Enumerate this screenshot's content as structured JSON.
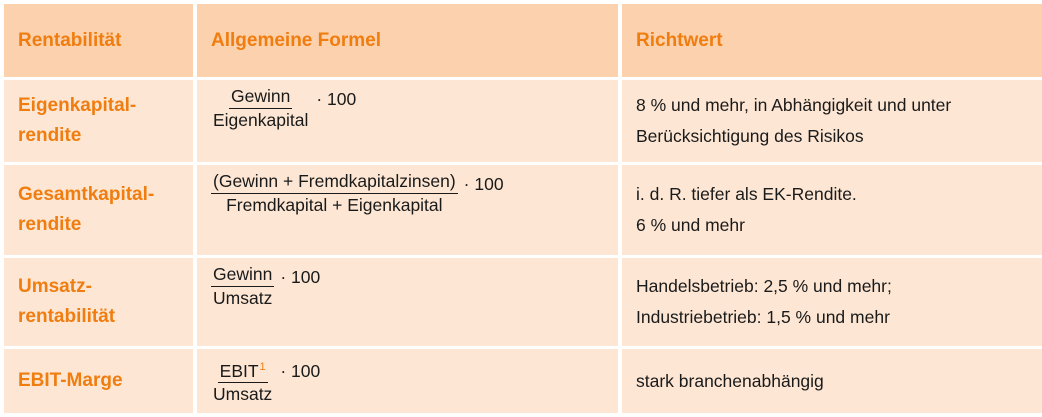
{
  "header": {
    "col1": "Rentabilität",
    "col2": "Allgemeine Formel",
    "col3": "Richtwert"
  },
  "rows": [
    {
      "name": "Eigenkapital-\nrendite",
      "numerator": "Gewinn",
      "denominator": "Eigenkapital",
      "multiplier": "· 100",
      "richtwert": "8 % und mehr, in Abhängigkeit und unter\nBerücksichtigung des Risikos"
    },
    {
      "name": "Gesamtkapital-\nrendite",
      "numerator": "(Gewinn + Fremdkapitalzinsen)",
      "denominator": "Fremdkapital + Eigenkapital",
      "multiplier": "· 100",
      "richtwert": "i. d. R. tiefer als EK-Rendite.\n6 % und mehr"
    },
    {
      "name": "Umsatz-\nrentabilität",
      "numerator": "Gewinn",
      "denominator": "Umsatz",
      "multiplier": "· 100",
      "richtwert": "Handelsbetrieb: 2,5 % und mehr;\nIndustriebetrieb: 1,5 % und mehr"
    },
    {
      "name": "EBIT-Marge",
      "numerator": "EBIT",
      "footnote": "1",
      "denominator": "Umsatz",
      "multiplier": "· 100",
      "richtwert": "stark branchenabhängig"
    }
  ],
  "colors": {
    "accent": "#f07d10",
    "header_bg": "#fcd1ad",
    "row_bg": "#fde7d4"
  }
}
